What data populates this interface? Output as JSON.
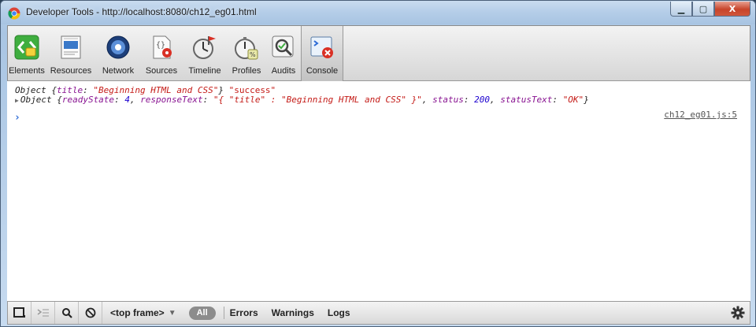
{
  "window": {
    "title": "Developer Tools - http://localhost:8080/ch12_eg01.html",
    "controls": {
      "minimize": "▁",
      "maximize": "▢",
      "close": "X"
    }
  },
  "toolbar": {
    "tools": [
      {
        "label": "Elements",
        "icon": "elements-icon"
      },
      {
        "label": "Resources",
        "icon": "resources-icon"
      },
      {
        "label": "Network",
        "icon": "network-icon"
      },
      {
        "label": "Sources",
        "icon": "sources-icon"
      },
      {
        "label": "Timeline",
        "icon": "timeline-icon"
      },
      {
        "label": "Profiles",
        "icon": "profiles-icon"
      },
      {
        "label": "Audits",
        "icon": "audits-icon"
      },
      {
        "label": "Console",
        "icon": "console-icon",
        "selected": true
      }
    ]
  },
  "console": {
    "line1": {
      "obj": "Object",
      "open": "{",
      "key": "title",
      "colon": ": ",
      "value": "\"Beginning HTML and CSS\"",
      "close": "}",
      "extra": "\"success\""
    },
    "line2": {
      "obj": "Object",
      "open": "{",
      "k1": "readyState",
      "v1": "4",
      "k2": "responseText",
      "v2": "\"{ \"title\" : \"Beginning HTML and CSS\" }\"",
      "k3": "status",
      "v3": "200",
      "k4": "statusText",
      "v4": "\"OK\"",
      "close": "}"
    },
    "source_link": "ch12_eg01.js:5",
    "prompt": "›"
  },
  "statusbar": {
    "frame_selector": "<top frame>",
    "frame_arrow": "▼",
    "all_label": "All",
    "filters": [
      "Errors",
      "Warnings",
      "Logs"
    ]
  },
  "colors": {
    "key": "#881391",
    "string": "#c41a16",
    "number": "#1c00cf",
    "prompt": "#2d6bd6"
  }
}
